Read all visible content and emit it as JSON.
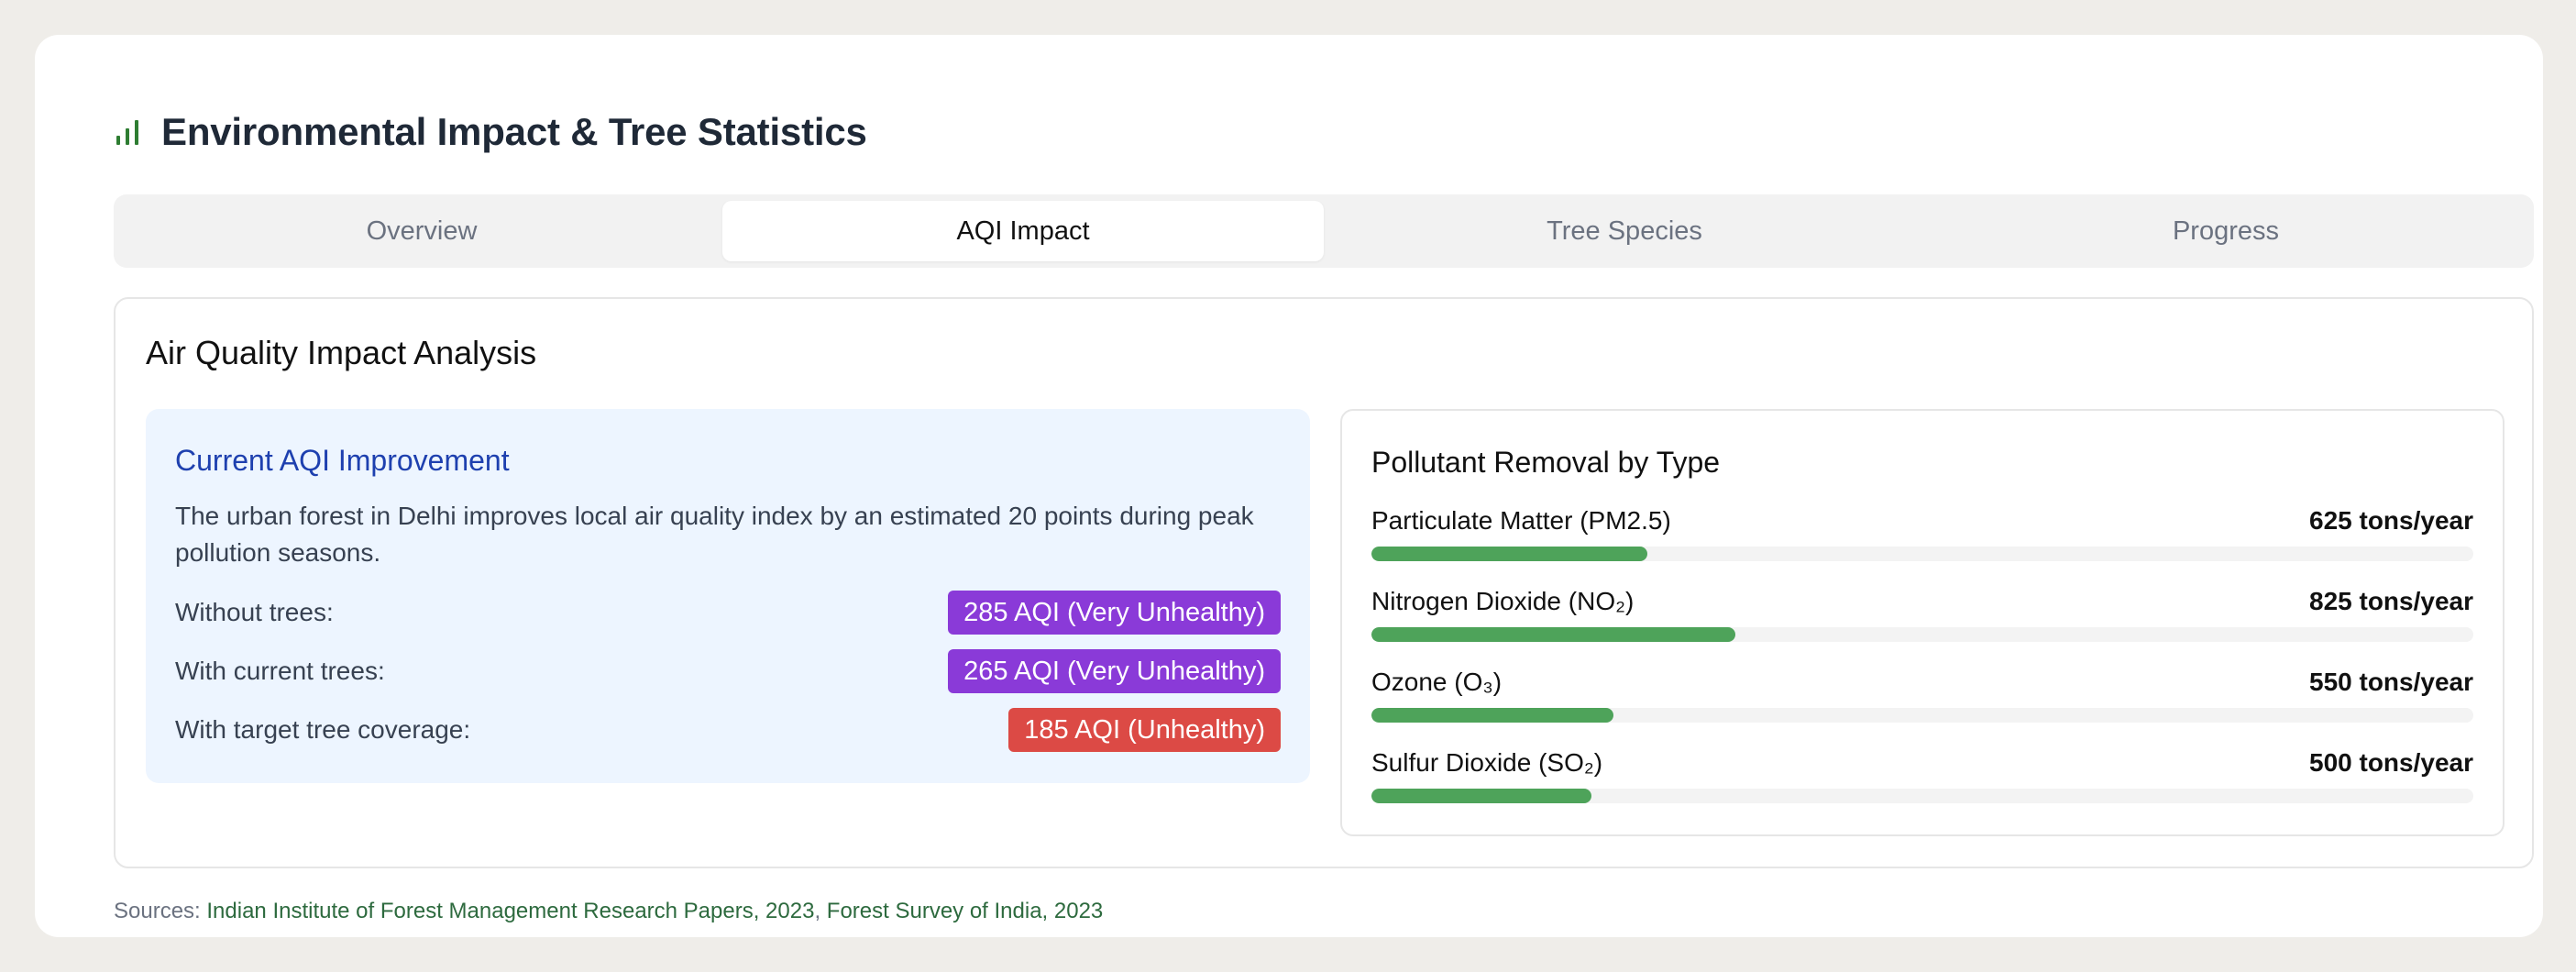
{
  "header": {
    "title": "Environmental Impact & Tree Statistics",
    "icon": "bar-chart-icon",
    "icon_color": "#2e7d32"
  },
  "tabs": [
    {
      "label": "Overview",
      "active": false
    },
    {
      "label": "AQI Impact",
      "active": true
    },
    {
      "label": "Tree Species",
      "active": false
    },
    {
      "label": "Progress",
      "active": false
    }
  ],
  "panel": {
    "title": "Air Quality Impact Analysis",
    "aqi": {
      "title": "Current AQI Improvement",
      "description": "The urban forest in Delhi improves local air quality index by an estimated 20 points during peak pollution seasons.",
      "rows": [
        {
          "label": "Without trees:",
          "badge": "285 AQI (Very Unhealthy)",
          "color": "#8a3ad8"
        },
        {
          "label": "With current trees:",
          "badge": "265 AQI (Very Unhealthy)",
          "color": "#8a3ad8"
        },
        {
          "label": "With target tree coverage:",
          "badge": "185 AQI (Unhealthy)",
          "color": "#dc4a45"
        }
      ]
    },
    "pollutants": {
      "title": "Pollutant Removal by Type",
      "items": [
        {
          "name": "Particulate Matter (PM2.5)",
          "value": "625 tons/year",
          "fill_percent": 25
        },
        {
          "name": "Nitrogen Dioxide (NO₂)",
          "value": "825 tons/year",
          "fill_percent": 33
        },
        {
          "name": "Ozone (O₃)",
          "value": "550 tons/year",
          "fill_percent": 22
        },
        {
          "name": "Sulfur Dioxide (SO₂)",
          "value": "500 tons/year",
          "fill_percent": 20
        }
      ],
      "bar_color": "#4ea35a"
    }
  },
  "sources": {
    "prefix": "Sources:",
    "links": [
      "Indian Institute of Forest Management Research Papers, 2023",
      "Forest Survey of India, 2023"
    ]
  }
}
